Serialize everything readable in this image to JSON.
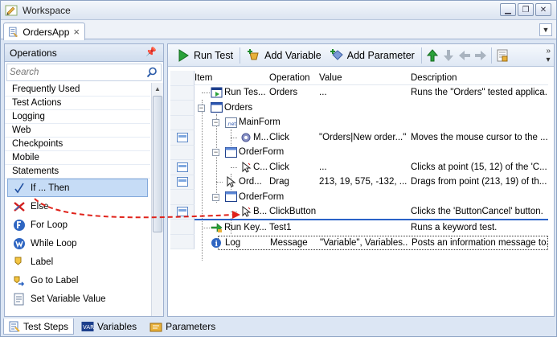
{
  "window": {
    "title": "Workspace",
    "controls": [
      "minimize",
      "restore",
      "close"
    ]
  },
  "tab": {
    "label": "OrdersApp",
    "close": "×"
  },
  "operations": {
    "title": "Operations",
    "search_placeholder": "Search",
    "categories": [
      "Frequently Used",
      "Test Actions",
      "Logging",
      "Web",
      "Checkpoints",
      "Mobile",
      "Statements"
    ],
    "items": [
      {
        "label": "If ... Then",
        "icon": "check-icon",
        "selected": true
      },
      {
        "label": "Else",
        "icon": "red-x-icon"
      },
      {
        "label": "For Loop",
        "icon": "for-loop-icon"
      },
      {
        "label": "While Loop",
        "icon": "while-loop-icon"
      },
      {
        "label": "Label",
        "icon": "label-icon"
      },
      {
        "label": "Go to Label",
        "icon": "go-to-label-icon"
      },
      {
        "label": "Set Variable Value",
        "icon": "set-variable-icon"
      }
    ]
  },
  "toolbar": {
    "run_test": "Run Test",
    "add_variable": "Add Variable",
    "add_parameter": "Add Parameter"
  },
  "grid": {
    "headers": {
      "item": "Item",
      "operation": "Operation",
      "value": "Value",
      "description": "Description"
    },
    "rows": [
      {
        "item": "Run Tes...",
        "operation": "Orders",
        "value": "...",
        "description": "Runs the \"Orders\" tested applica..."
      },
      {
        "item": "Orders",
        "operation": "",
        "value": "",
        "description": ""
      },
      {
        "item": "MainForm",
        "operation": "",
        "value": "",
        "description": ""
      },
      {
        "item": "M...",
        "operation": "Click",
        "value": "\"Orders|New order...\"",
        "description": "Moves the mouse cursor to the ..."
      },
      {
        "item": "OrderForm",
        "operation": "",
        "value": "",
        "description": ""
      },
      {
        "item": "C...",
        "operation": "Click",
        "value": "...",
        "description": "Clicks at point (15, 12) of the 'C..."
      },
      {
        "item": "Ord...",
        "operation": "Drag",
        "value": "213, 19, 575, -132, ...",
        "description": "Drags from point (213, 19) of th..."
      },
      {
        "item": "OrderForm",
        "operation": "",
        "value": "",
        "description": ""
      },
      {
        "item": "B...",
        "operation": "ClickButton",
        "value": "",
        "description": "Clicks the 'ButtonCancel' button."
      },
      {
        "item": "Run Key...",
        "operation": "Test1",
        "value": "",
        "description": "Runs a keyword test."
      },
      {
        "item": "Log",
        "operation": "Message",
        "value": "\"Variable\", Variables...",
        "description": "Posts an information message to..."
      }
    ]
  },
  "bottom_tabs": [
    {
      "label": "Test Steps",
      "active": true
    },
    {
      "label": "Variables"
    },
    {
      "label": "Parameters"
    }
  ],
  "colors": {
    "accent": "#2a62c8",
    "drag_arrow": "#e0221a",
    "selection": "#c6dcf6"
  }
}
